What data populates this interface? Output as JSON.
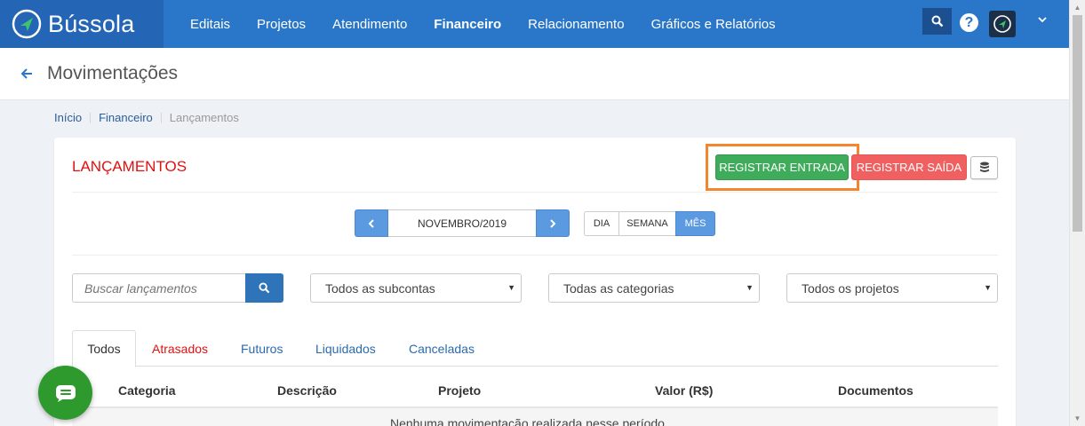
{
  "app": {
    "brand": "Bússola"
  },
  "nav": {
    "items": [
      {
        "label": "Editais"
      },
      {
        "label": "Projetos"
      },
      {
        "label": "Atendimento"
      },
      {
        "label": "Financeiro",
        "active": true
      },
      {
        "label": "Relacionamento"
      },
      {
        "label": "Gráficos e Relatórios"
      }
    ],
    "help_label": "?"
  },
  "page": {
    "title": "Movimentações"
  },
  "breadcrumb": [
    "Início",
    "Financeiro",
    "Lançamentos"
  ],
  "card": {
    "title": "LANÇAMENTOS",
    "register_in": "REGISTRAR ENTRADA",
    "register_out": "REGISTRAR SAÍDA"
  },
  "period": {
    "label": "NOVEMBRO/2019",
    "views": [
      "DIA",
      "SEMANA",
      "MÊS"
    ],
    "selected_view": "MÊS"
  },
  "filters": {
    "search_placeholder": "Buscar lançamentos",
    "subaccounts": "Todos as subcontas",
    "categories": "Todas as categorias",
    "projects": "Todos os projetos"
  },
  "tabs": [
    "Todos",
    "Atrasados",
    "Futuros",
    "Liquidados",
    "Canceladas"
  ],
  "table": {
    "columns": [
      "Categoria",
      "Descrição",
      "Projeto",
      "Valor (R$)",
      "Documentos"
    ],
    "empty_message": "Nenhuma movimentação realizada nesse período."
  },
  "colors": {
    "navbar": "#2a76c9",
    "brand_bg": "#2466b5",
    "entrada": "#3eac5a",
    "saida": "#f16060",
    "title_red": "#e01010",
    "highlight": "#f5852c",
    "chat": "#2e9a2e"
  },
  "icons": [
    "compass-icon",
    "search-icon",
    "help-icon",
    "avatar-icon",
    "chevron-down-icon",
    "back-arrow-icon",
    "database-icon",
    "chat-icon"
  ]
}
